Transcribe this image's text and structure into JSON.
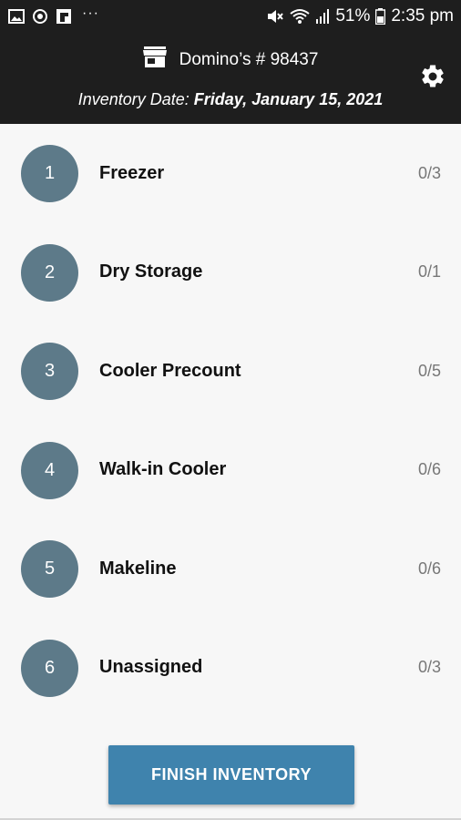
{
  "status_bar": {
    "battery": "51%",
    "time": "2:35 pm",
    "left_icons": [
      "image-icon",
      "sync-icon",
      "flipboard-icon"
    ],
    "more_dots": "···"
  },
  "header": {
    "store_name": "Domino’s # 98437",
    "inventory_label": "Inventory Date: ",
    "inventory_date": "Friday, January 15, 2021"
  },
  "items": [
    {
      "number": "1",
      "name": "Freezer",
      "count": "0/3"
    },
    {
      "number": "2",
      "name": "Dry Storage",
      "count": "0/1"
    },
    {
      "number": "3",
      "name": "Cooler Precount",
      "count": "0/5"
    },
    {
      "number": "4",
      "name": "Walk-in Cooler",
      "count": "0/6"
    },
    {
      "number": "5",
      "name": "Makeline",
      "count": "0/6"
    },
    {
      "number": "6",
      "name": "Unassigned",
      "count": "0/3"
    }
  ],
  "finish_button": {
    "label": "FINISH INVENTORY"
  },
  "colors": {
    "header_bg": "#1e1e1e",
    "circle": "#5d7a89",
    "button": "#3f83ad",
    "background": "#f7f7f7"
  }
}
